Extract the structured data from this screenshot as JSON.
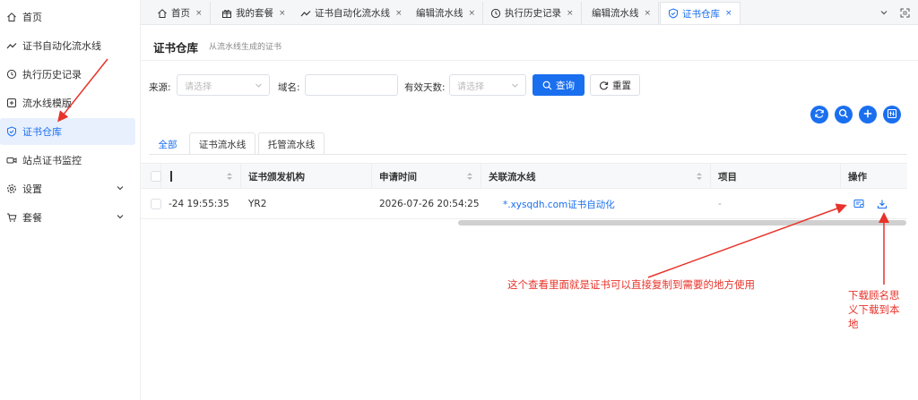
{
  "sidebar": {
    "items": [
      {
        "label": "首页",
        "icon": "home-icon"
      },
      {
        "label": "证书自动化流水线",
        "icon": "trend-icon"
      },
      {
        "label": "执行历史记录",
        "icon": "history-icon"
      },
      {
        "label": "流水线模版",
        "icon": "template-icon"
      },
      {
        "label": "证书仓库",
        "icon": "shield-icon",
        "active": true
      },
      {
        "label": "站点证书监控",
        "icon": "camera-icon"
      },
      {
        "label": "设置",
        "icon": "gear-icon",
        "expandable": true
      },
      {
        "label": "套餐",
        "icon": "cart-icon",
        "expandable": true
      }
    ]
  },
  "tabs": [
    {
      "label": "首页",
      "icon": "home-icon"
    },
    {
      "label": "我的套餐",
      "icon": "gift-icon"
    },
    {
      "label": "证书自动化流水线",
      "icon": "trend-icon"
    },
    {
      "label": "编辑流水线",
      "icon": ""
    },
    {
      "label": "执行历史记录",
      "icon": "history-icon"
    },
    {
      "label": "编辑流水线",
      "icon": ""
    },
    {
      "label": "证书仓库",
      "icon": "shield-icon",
      "active": true
    }
  ],
  "tab_close": "×",
  "header": {
    "title": "证书仓库",
    "subtitle": "从流水线生成的证书"
  },
  "filters": {
    "source_label": "来源:",
    "source_placeholder": "请选择",
    "domain_label": "域名:",
    "domain_value": "",
    "days_label": "有效天数:",
    "days_placeholder": "请选择",
    "query_label": "查询",
    "reset_label": "重置"
  },
  "toolbar_icons": [
    "refresh-icon",
    "search-icon",
    "add-icon",
    "columns-icon"
  ],
  "subtabs": [
    "全部",
    "证书流水线",
    "托管流水线"
  ],
  "table": {
    "columns": [
      "",
      "证书颁发机构",
      "申请时间",
      "关联流水线",
      "项目",
      "操作"
    ],
    "rows": [
      {
        "expires": "-24 19:55:35",
        "issuer": "YR2",
        "applied": "2026-07-26 20:54:25",
        "pipeline": "*.xysqdh.com证书自动化",
        "project": "-"
      }
    ]
  },
  "annotations": {
    "view_note": "这个查看里面就是证书可以直接复制到需要的地方使用",
    "download_note_lines": [
      "下载顾名思",
      "义下载到本",
      "地"
    ]
  },
  "colors": {
    "accent": "#1a6fef",
    "annotation": "#e8332a"
  }
}
